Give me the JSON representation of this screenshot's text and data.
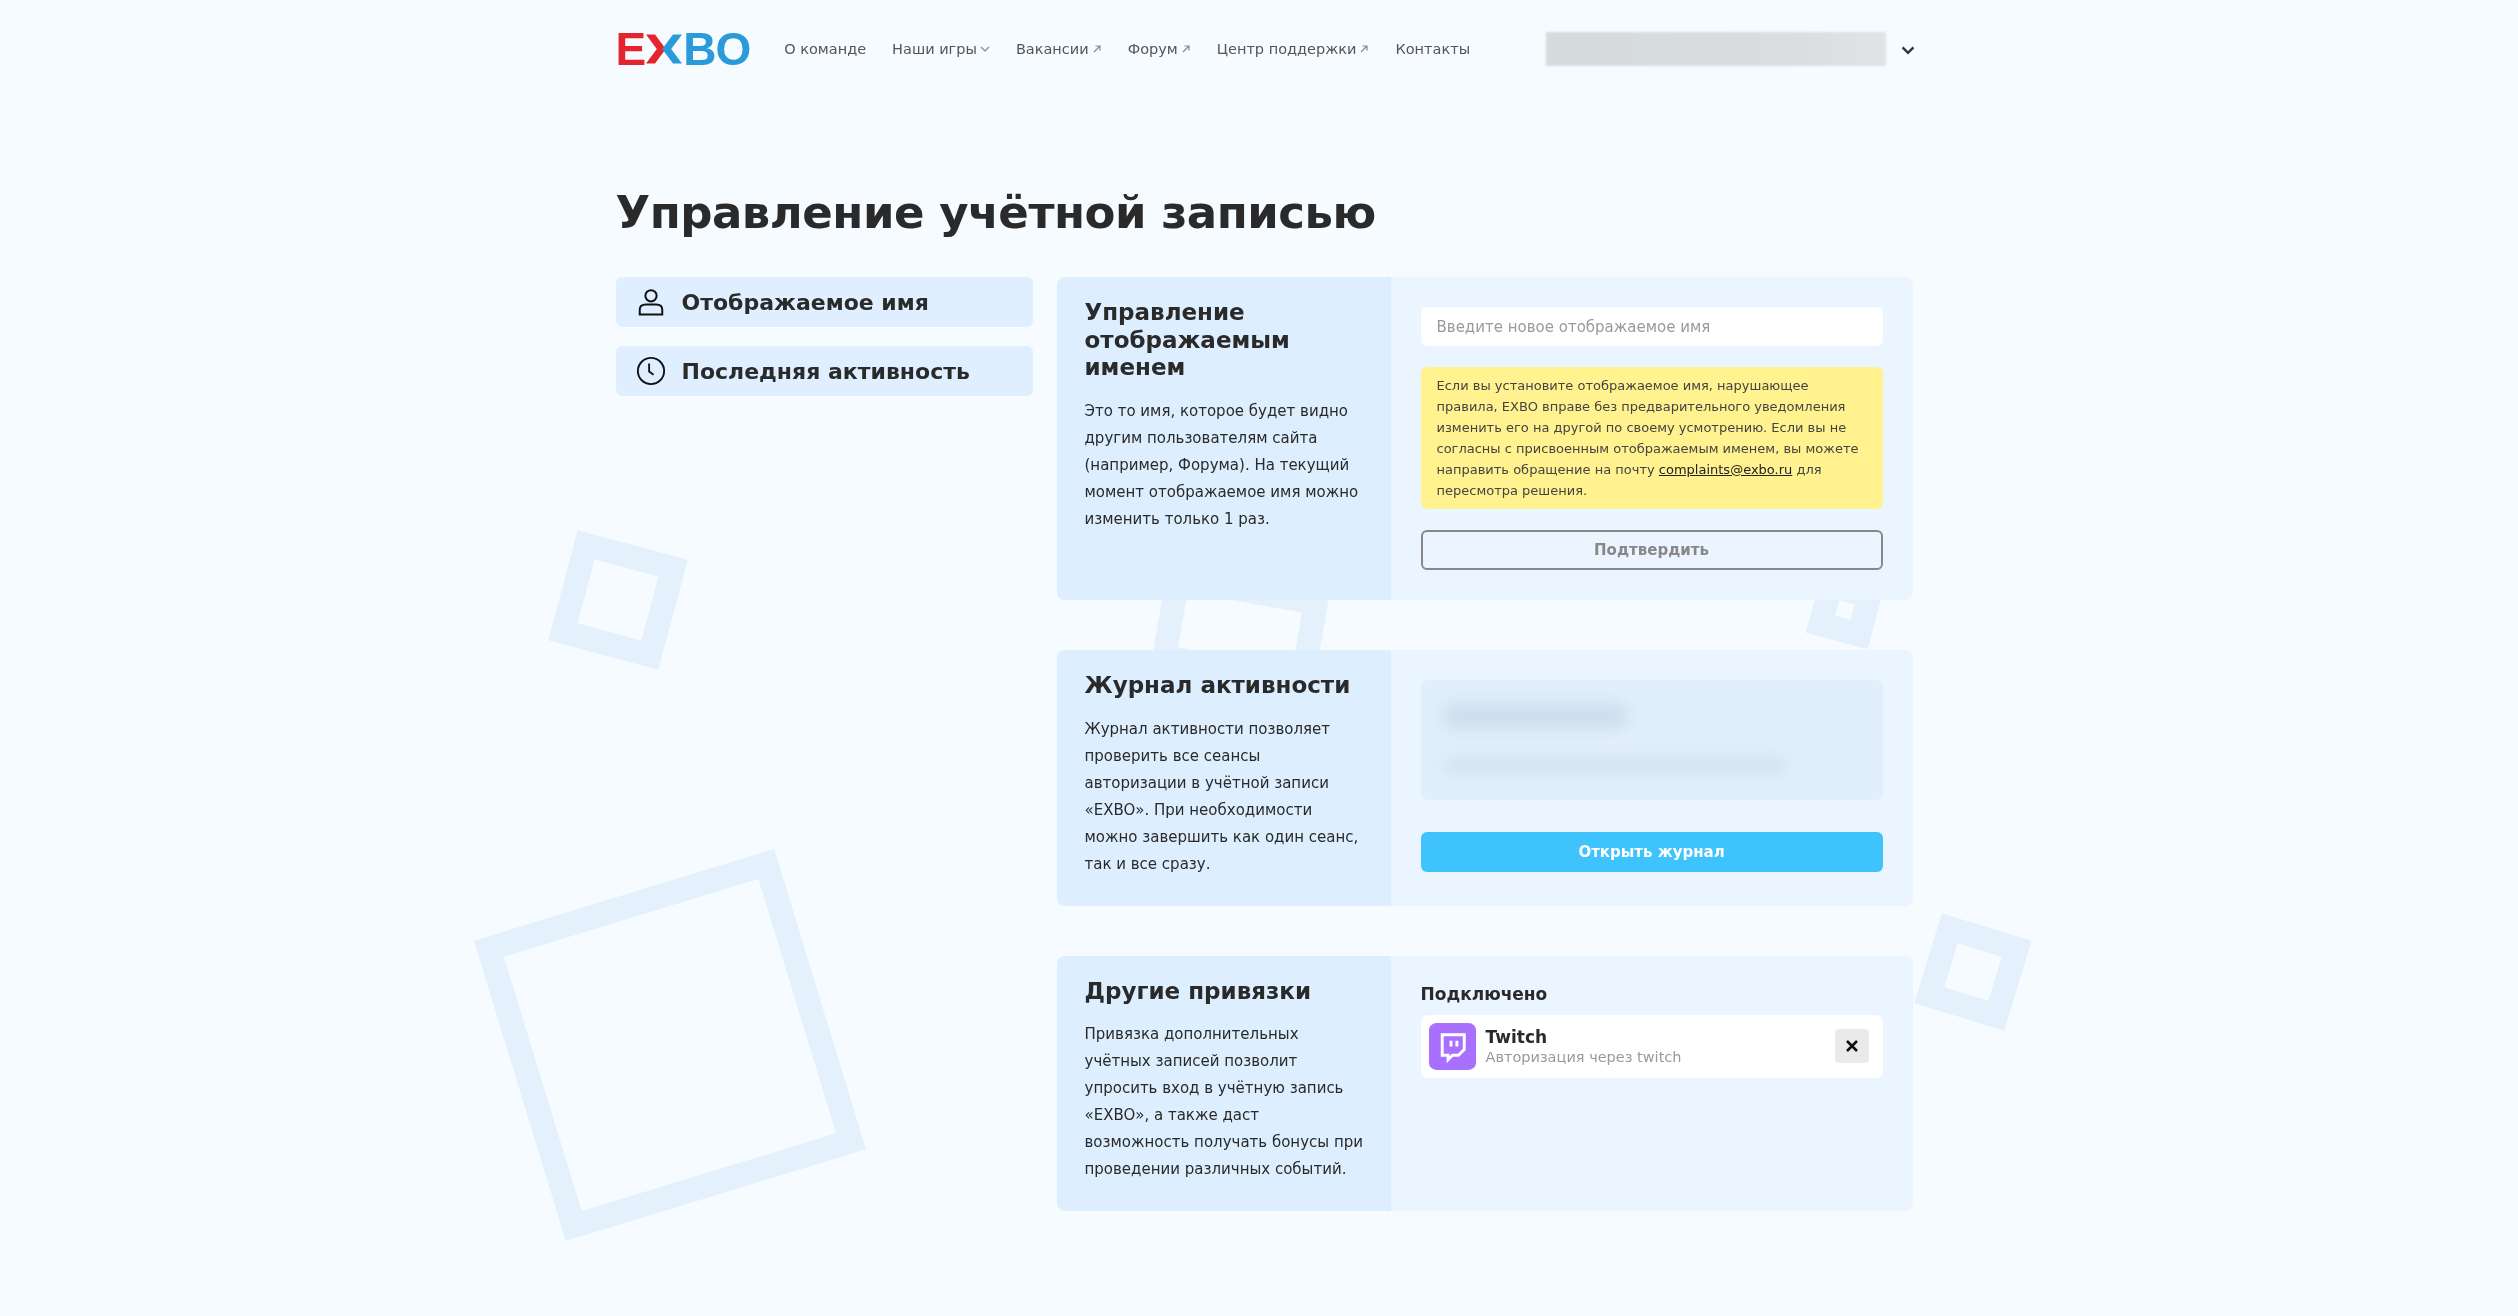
{
  "header": {
    "logo": {
      "left": "E",
      "right": "BO"
    },
    "nav": [
      {
        "label": "О команде",
        "kind": "plain"
      },
      {
        "label": "Наши игры",
        "kind": "dropdown"
      },
      {
        "label": "Вакансии",
        "kind": "external"
      },
      {
        "label": "Форум",
        "kind": "external"
      },
      {
        "label": "Центр поддержки",
        "kind": "external"
      },
      {
        "label": "Контакты",
        "kind": "plain"
      }
    ]
  },
  "title": "Управление учётной записью",
  "sidebar": {
    "items": [
      {
        "label": "Отображаемое имя",
        "kind": "user"
      },
      {
        "label": "Последняя активность",
        "kind": "clock"
      }
    ]
  },
  "sections": [
    {
      "kind": "name",
      "title": "Управление отображаемым именем",
      "description": "Это то имя, которое будет видно другим пользователям сайта (например, Форума). На текущий момент отображаемое имя можно изменить только 1 раз.",
      "placeholder": "Введите новое отображаемое имя",
      "notice_before": "Если вы установите отображаемое имя, нарушающее правила, EXBO вправе без предварительного уведомления изменить его на другой по своему усмотрению. Если вы не согласны с присвоенным отображаемым именем, вы можете направить обращение на почту",
      "notice_link": "complaints@exbo.ru",
      "notice_after": "для пересмотра решения.",
      "button": {
        "label": "Подтвердить",
        "disabled": true
      }
    },
    {
      "kind": "log",
      "title": "Журнал активности",
      "description": "Журнал активности позволяет проверить все сеансы авторизации в учётной записи «EXBO». При необходимости можно завершить как один сеанс, так и все сразу.",
      "button": {
        "label": "Открыть журнал",
        "disabled": false
      }
    },
    {
      "kind": "links",
      "title": "Другие привязки",
      "description": "Привязка дополнительных учётных записей позволит упросить вход в учётную запись «EXBO», а также даст возможность получать бонусы при проведении различных событий.",
      "connected_label": "Подключено",
      "connections": [
        {
          "name": "Twitch",
          "subtitle": "Авторизация через twitch"
        }
      ]
    }
  ]
}
